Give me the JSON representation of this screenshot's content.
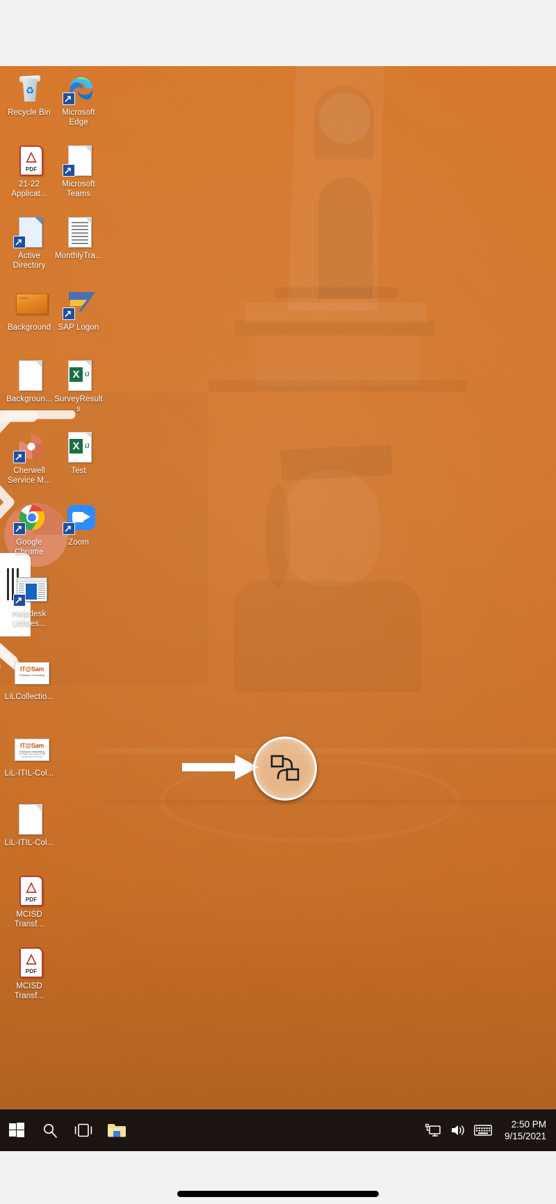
{
  "platform": {
    "type": "windows-desktop-screenshot-on-phone",
    "wallpaper_description": "orange-tinted photo of a university clock tower and a graduate"
  },
  "desktop": {
    "icons": [
      {
        "label": "Recycle Bin",
        "icon": "recycle-bin-icon",
        "shortcut": false,
        "col": 0,
        "row": 0
      },
      {
        "label": "Microsoft Edge",
        "icon": "microsoft-edge-icon",
        "shortcut": true,
        "col": 1,
        "row": 0
      },
      {
        "label": "21-22 Applicat...",
        "icon": "pdf-file-icon",
        "shortcut": false,
        "col": 0,
        "row": 1
      },
      {
        "label": "Microsoft Teams",
        "icon": "document-icon",
        "shortcut": true,
        "col": 1,
        "row": 1
      },
      {
        "label": "Active Directory",
        "icon": "blue-document-icon",
        "shortcut": true,
        "col": 0,
        "row": 2
      },
      {
        "label": "MonthlyTra...",
        "icon": "lined-document-icon",
        "shortcut": false,
        "col": 1,
        "row": 2
      },
      {
        "label": "Background",
        "icon": "image-thumbnail-icon",
        "shortcut": false,
        "col": 0,
        "row": 3
      },
      {
        "label": "SAP Logon",
        "icon": "sap-logon-icon",
        "shortcut": true,
        "col": 1,
        "row": 3
      },
      {
        "label": "Backgroun...",
        "icon": "document-icon",
        "shortcut": false,
        "col": 0,
        "row": 4
      },
      {
        "label": "SurveyResults",
        "icon": "excel-file-icon",
        "shortcut": false,
        "col": 1,
        "row": 4
      },
      {
        "label": "Cherwell Service M...",
        "icon": "cherwell-icon",
        "shortcut": true,
        "col": 0,
        "row": 5
      },
      {
        "label": "Test",
        "icon": "excel-file-icon",
        "shortcut": false,
        "col": 1,
        "row": 5
      },
      {
        "label": "Google Chrome",
        "icon": "google-chrome-icon",
        "shortcut": true,
        "col": 0,
        "row": 6
      },
      {
        "label": "Zoom",
        "icon": "zoom-app-icon",
        "shortcut": true,
        "col": 1,
        "row": 6
      },
      {
        "label": "Helpdesk Utilities...",
        "icon": "helpdesk-window-icon",
        "shortcut": true,
        "col": 0,
        "row": 7
      },
      {
        "label": "LiLCollectio...",
        "icon": "it-at-sam-icon",
        "shortcut": false,
        "col": 0,
        "row": 8
      },
      {
        "label": "LiL-ITIL-Col...",
        "icon": "it-at-sam-icon",
        "shortcut": false,
        "col": 0,
        "row": 9
      },
      {
        "label": "LiL-ITIL-Col...",
        "icon": "document-icon",
        "shortcut": false,
        "col": 0,
        "row": 10
      },
      {
        "label": "MCISD Transf...",
        "icon": "pdf-file-icon",
        "shortcut": false,
        "col": 0,
        "row": 11
      },
      {
        "label": "MCISD Transf...",
        "icon": "pdf-file-icon",
        "shortcut": false,
        "col": 0,
        "row": 12
      }
    ],
    "itsam_card": {
      "brand": "IT@Sam",
      "sub": "Employee Onboarding",
      "sub2": "Information Technology @ Sam Houston State University"
    }
  },
  "callout": {
    "arrow": "right-arrow-pointer",
    "target_icon": "task-view-switch-icon",
    "target_description": "circular highlight over the task view / switch windows button"
  },
  "taskbar": {
    "buttons": [
      {
        "name": "start-button",
        "icon": "windows-logo-icon"
      },
      {
        "name": "search-button",
        "icon": "search-icon"
      },
      {
        "name": "task-view-button",
        "icon": "task-view-icon"
      },
      {
        "name": "file-explorer-button",
        "icon": "folder-icon"
      }
    ],
    "tray": [
      {
        "name": "network-tray-icon",
        "icon": "monitor-network-icon"
      },
      {
        "name": "volume-tray-icon",
        "icon": "speaker-icon"
      },
      {
        "name": "keyboard-tray-icon",
        "icon": "keyboard-icon"
      }
    ],
    "clock": {
      "time": "2:50 PM",
      "date": "9/15/2021"
    }
  },
  "colors": {
    "wallpaper_orange": "#d9782b",
    "taskbar": "#1b1410",
    "highlight_circle_fill": "#ffecd4",
    "highlight_circle_border": "#ffffff",
    "arrow": "#ffffff",
    "phone_chrome": "#f2f2f2"
  }
}
